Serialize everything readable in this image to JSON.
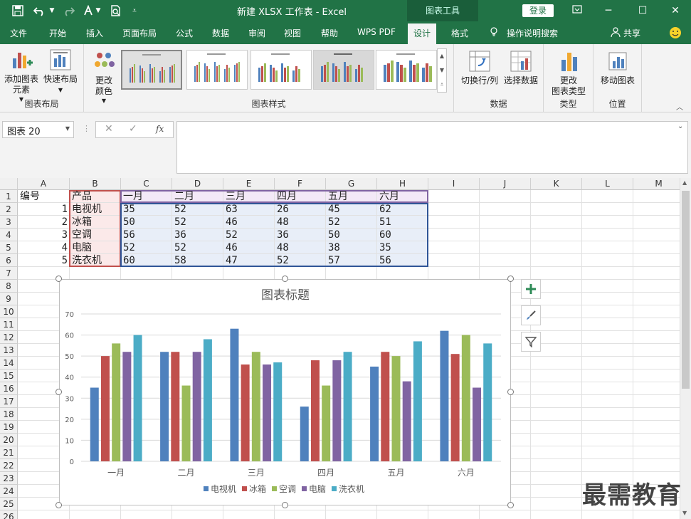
{
  "window": {
    "title": "新建 XLSX 工作表  -  Excel",
    "context_tool": "图表工具",
    "login": "登录"
  },
  "tabs": [
    "文件",
    "开始",
    "插入",
    "页面布局",
    "公式",
    "数据",
    "审阅",
    "视图",
    "帮助",
    "WPS PDF",
    "设计",
    "格式"
  ],
  "active_tab": "设计",
  "tell_me": "操作说明搜索",
  "share": "共享",
  "ribbon": {
    "add_chart_element": "添加图表\n元素",
    "quick_layout": "快速布局",
    "change_colors": "更改\n颜色",
    "group_layout": "图表布局",
    "group_styles": "图表样式",
    "switch_row_col": "切换行/列",
    "select_data": "选择数据",
    "group_data": "数据",
    "change_type": "更改\n图表类型",
    "group_type": "类型",
    "move_chart": "移动图表",
    "group_location": "位置"
  },
  "name_box": "图表 20",
  "columns": [
    "A",
    "B",
    "C",
    "D",
    "E",
    "F",
    "G",
    "H",
    "I",
    "J",
    "K",
    "L",
    "M"
  ],
  "rows": [
    "1",
    "2",
    "3",
    "4",
    "5",
    "6",
    "7",
    "8",
    "9",
    "10",
    "11",
    "12",
    "13",
    "14",
    "15",
    "16",
    "17",
    "18",
    "19",
    "20",
    "21",
    "22",
    "23",
    "24",
    "25",
    "26"
  ],
  "table": {
    "headers": [
      "编号",
      "产品",
      "一月",
      "二月",
      "三月",
      "四月",
      "五月",
      "六月"
    ],
    "data": [
      [
        "1",
        "电视机",
        "35",
        "52",
        "63",
        "26",
        "45",
        "62"
      ],
      [
        "2",
        "冰箱",
        "50",
        "52",
        "46",
        "48",
        "52",
        "51"
      ],
      [
        "3",
        "空调",
        "56",
        "36",
        "52",
        "36",
        "50",
        "60"
      ],
      [
        "4",
        "电脑",
        "52",
        "52",
        "46",
        "48",
        "38",
        "35"
      ],
      [
        "5",
        "洗衣机",
        "60",
        "58",
        "47",
        "52",
        "57",
        "56"
      ]
    ]
  },
  "chart_data": {
    "type": "bar",
    "title": "图表标题",
    "categories": [
      "一月",
      "二月",
      "三月",
      "四月",
      "五月",
      "六月"
    ],
    "series": [
      {
        "name": "电视机",
        "color": "#4f81bd",
        "values": [
          35,
          52,
          63,
          26,
          45,
          62
        ]
      },
      {
        "name": "冰箱",
        "color": "#c0504d",
        "values": [
          50,
          52,
          46,
          48,
          52,
          51
        ]
      },
      {
        "name": "空调",
        "color": "#9bbb59",
        "values": [
          56,
          36,
          52,
          36,
          50,
          60
        ]
      },
      {
        "name": "电脑",
        "color": "#8064a2",
        "values": [
          52,
          52,
          46,
          48,
          38,
          35
        ]
      },
      {
        "name": "洗衣机",
        "color": "#4bacc6",
        "values": [
          60,
          58,
          47,
          52,
          57,
          56
        ]
      }
    ],
    "yticks": [
      "0",
      "10",
      "20",
      "30",
      "40",
      "50",
      "60",
      "70"
    ],
    "ylim": [
      0,
      70
    ],
    "grid": true,
    "legend_position": "bottom"
  },
  "watermark": "最需教育",
  "colors": {
    "brand": "#217346",
    "header_fill": "#f3e9f7",
    "data_fill": "#e8eef8",
    "product_fill": "#fbe9e9"
  }
}
